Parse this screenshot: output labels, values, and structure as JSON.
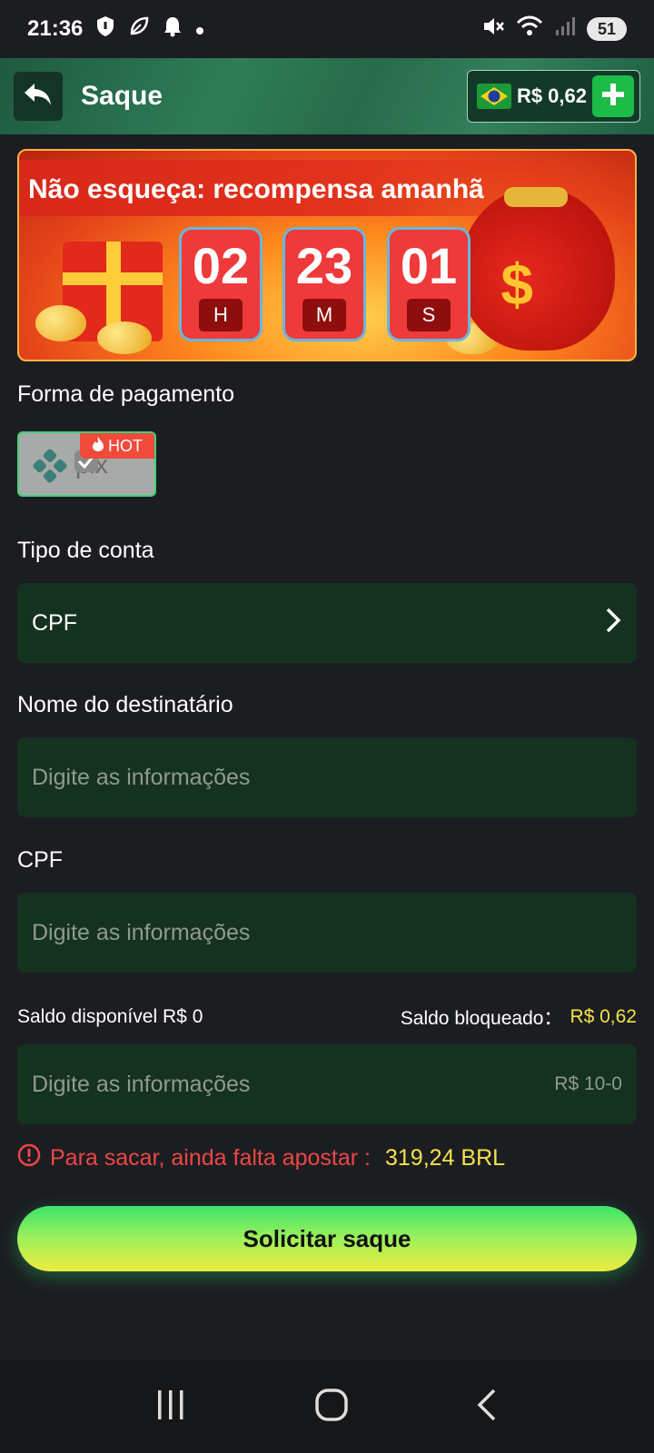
{
  "status_bar": {
    "time": "21:36",
    "battery": "51"
  },
  "header": {
    "title": "Saque",
    "balance": "R$ 0,62"
  },
  "banner": {
    "title": "Não esqueça: recompensa amanhã",
    "hours": "02",
    "hours_unit": "H",
    "minutes": "23",
    "minutes_unit": "M",
    "seconds": "01",
    "seconds_unit": "S"
  },
  "payment": {
    "label": "Forma de pagamento",
    "hot_tag": "HOT"
  },
  "account_type": {
    "label": "Tipo de conta",
    "value": "CPF"
  },
  "recipient": {
    "label": "Nome do destinatário",
    "placeholder": "Digite as informações"
  },
  "cpf": {
    "label": "CPF",
    "placeholder": "Digite as informações"
  },
  "saldo": {
    "available_label": "Saldo disponível R$",
    "available_value": "0",
    "blocked_label": "Saldo bloqueado：",
    "blocked_value": "R$ 0,62"
  },
  "amount": {
    "placeholder": "Digite as informações",
    "range": "R$ 10-0"
  },
  "warning": {
    "text": "Para sacar, ainda falta apostar :",
    "amount": "319,24 BRL"
  },
  "submit": {
    "label": "Solicitar saque"
  },
  "colors": {
    "accent_green": "#1dbb48",
    "field_bg": "#15311f",
    "warning_red": "#ee4646",
    "highlight_yellow": "#f4e24a"
  }
}
